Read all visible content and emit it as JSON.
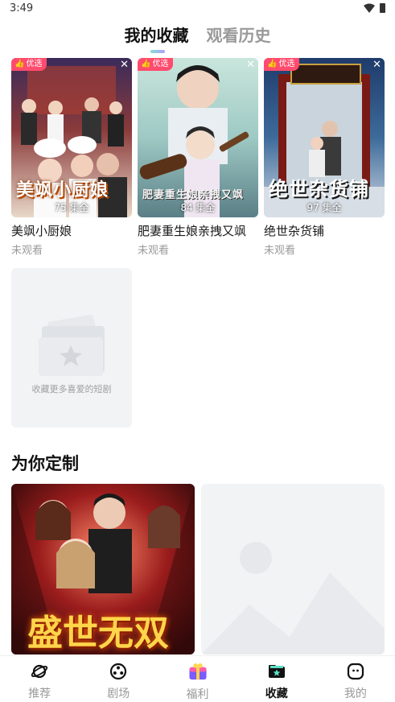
{
  "status_bar": {
    "time": "3:49"
  },
  "tabs": [
    {
      "label": "我的收藏",
      "active": true
    },
    {
      "label": "观看历史",
      "active": false
    }
  ],
  "favorites": [
    {
      "poster_title": "美飒小厨娘",
      "badge": "优选",
      "episodes": "75 集全",
      "name": "美飒小厨娘",
      "status": "未观看"
    },
    {
      "poster_title": "肥妻重生娘亲拽又飒",
      "badge": "优选",
      "episodes": "84 集全",
      "name": "肥妻重生娘亲拽又飒",
      "status": "未观看"
    },
    {
      "poster_title": "绝世杂货铺",
      "badge": "优选",
      "episodes": "97 集全",
      "name": "绝世杂货铺",
      "status": "未观看"
    }
  ],
  "add_more_text": "收藏更多喜爱的短剧",
  "section_title": "为你定制",
  "recommend": {
    "poster_title": "盛世无双"
  },
  "bottom_nav": [
    {
      "label": "推荐",
      "icon": "planet-icon",
      "active": false
    },
    {
      "label": "剧场",
      "icon": "film-reel-icon",
      "active": false
    },
    {
      "label": "福利",
      "icon": "gift-box-icon",
      "active": false
    },
    {
      "label": "收藏",
      "icon": "star-folder-icon",
      "active": true
    },
    {
      "label": "我的",
      "icon": "profile-face-icon",
      "active": false
    }
  ],
  "colors": {
    "badge": "#ff4b6e",
    "accent_gradient_start": "#7fe3d3",
    "accent_gradient_end": "#b59cff"
  }
}
